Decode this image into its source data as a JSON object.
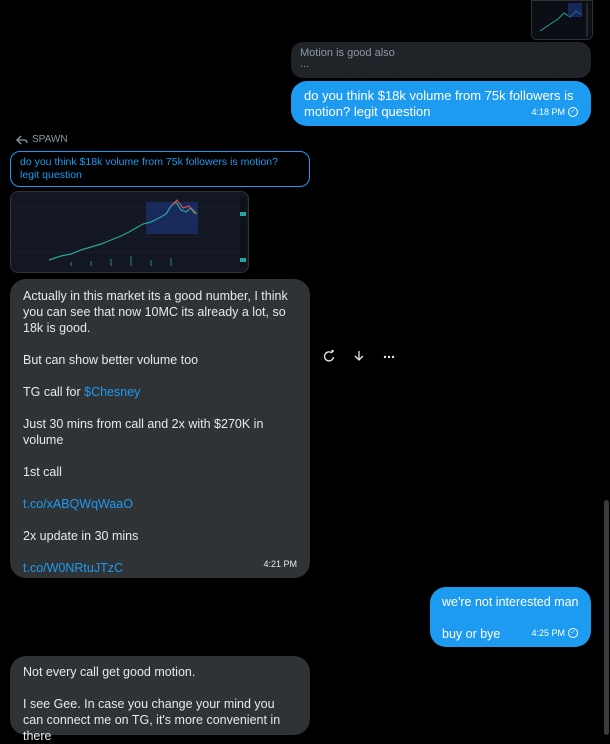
{
  "messages": {
    "top_quote": {
      "text": "Motion is good also",
      "ellipsis": "..."
    },
    "out1": {
      "text": "do you think $18k volume from 75k followers is motion? legit question",
      "time": "4:18 PM"
    },
    "reply_header": "SPAWN",
    "in_quote": "do you think $18k volume from 75k followers is motion? legit question",
    "in1": {
      "p1": "Actually in this market its a good number, I think you can see that now 10MC its already a lot, so 18k is good.",
      "p2": "But can show better volume too",
      "p3_prefix": "TG call for ",
      "p3_link": "$Chesney",
      "p4": "Just 30 mins from call and 2x with $270K in volume",
      "p5": "1st call",
      "p6_link": "t.co/xABQWqWaaO",
      "p7": "2x update in 30 mins",
      "p8_link": "t.co/W0NRtuJTzC",
      "time": "4:21 PM"
    },
    "out2": {
      "line1": "we're not interested man",
      "line2": "buy or bye",
      "time": "4:25 PM"
    },
    "in2": {
      "p1": "Not every call get good motion.",
      "p2": "I see Gee. In case you change your mind you can connect me on TG, it's more convenient in there"
    }
  },
  "icons": [
    "reply-icon",
    "react-icon",
    "download-icon",
    "more-icon",
    "sent-check-icon"
  ],
  "colors": {
    "accent": "#1d9bf0",
    "bubble_in": "#2f3336",
    "background": "#000000"
  }
}
